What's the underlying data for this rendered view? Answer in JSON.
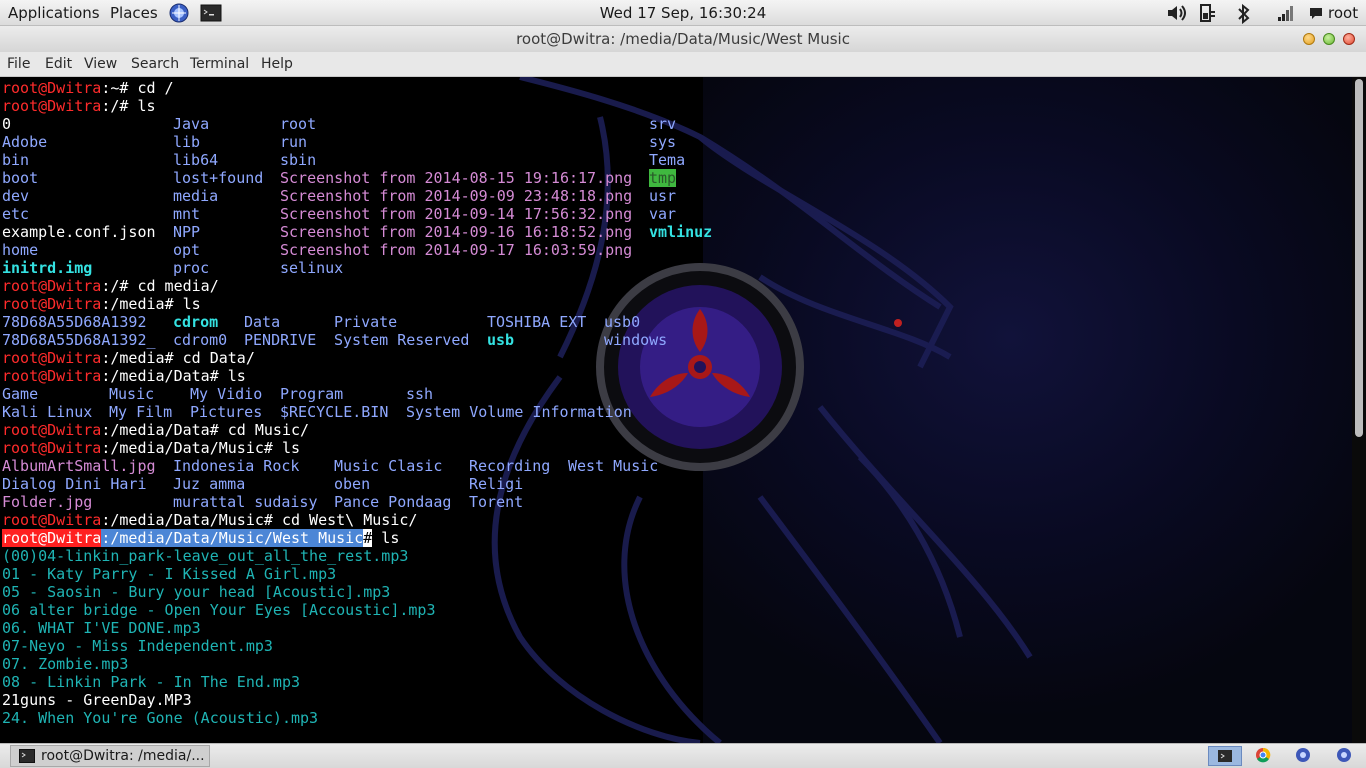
{
  "top_panel": {
    "applications_label": "Applications",
    "places_label": "Places",
    "clock": "Wed 17 Sep, 16:30:24",
    "user": "root",
    "icons": [
      "web-browser-icon",
      "terminal-launcher-icon",
      "volume-icon",
      "battery-icon",
      "bluetooth-icon",
      "network-icon",
      "chat-icon"
    ]
  },
  "window": {
    "title": "root@Dwitra: /media/Data/Music/West Music",
    "menu": {
      "file": "File",
      "edit": "Edit",
      "view": "View",
      "search": "Search",
      "terminal": "Terminal",
      "help": "Help"
    }
  },
  "terminal": {
    "prompt_user": "root@Dwitra",
    "lines": {
      "l1_path": ":~",
      "l1_cmd": "# cd /",
      "l2_path": ":/",
      "l2_cmd": "# ls",
      "root_ls": {
        "col1": [
          "0",
          "Adobe",
          "bin",
          "boot",
          "dev",
          "etc",
          "example.conf.json",
          "home",
          "initrd.img"
        ],
        "col2": [
          "Java",
          "lib",
          "lib64",
          "lost+found",
          "media",
          "mnt",
          "NPP",
          "opt",
          "proc"
        ],
        "col3": [
          "root",
          "run",
          "sbin",
          "Screenshot from 2014-08-15 19:16:17.png",
          "Screenshot from 2014-09-09 23:48:18.png",
          "Screenshot from 2014-09-14 17:56:32.png",
          "Screenshot from 2014-09-16 16:18:52.png",
          "Screenshot from 2014-09-17 16:03:59.png",
          "selinux"
        ],
        "col4": [
          "srv",
          "sys",
          "Tema",
          "tmp",
          "usr",
          "var",
          "vmlinuz"
        ]
      },
      "l3_path": ":/",
      "l3_cmd": "# cd media/",
      "l4_path": ":/media",
      "l4_cmd": "# ls",
      "media_ls": {
        "r1": [
          "78D68A55D68A1392",
          "cdrom",
          "Data",
          "Private",
          "TOSHIBA EXT",
          "usb0"
        ],
        "r2": [
          "78D68A55D68A1392_",
          "cdrom0",
          "PENDRIVE",
          "System Reserved",
          "usb",
          "windows"
        ]
      },
      "l5_path": ":/media",
      "l5_cmd": "# cd Data/",
      "l6_path": ":/media/Data",
      "l6_cmd": "# ls",
      "data_ls": {
        "r1": [
          "Game",
          "Music",
          "My Vidio",
          "Program",
          "ssh"
        ],
        "r2": [
          "Kali Linux",
          "My Film",
          "Pictures",
          "$RECYCLE.BIN",
          "System Volume Information"
        ]
      },
      "l7_path": ":/media/Data",
      "l7_cmd": "# cd Music/",
      "l8_path": ":/media/Data/Music",
      "l8_cmd": "# ls",
      "music_ls": {
        "r1": [
          "AlbumArtSmall.jpg",
          "Indonesia Rock",
          "Music Clasic",
          "Recording",
          "West Music"
        ],
        "r2": [
          "Dialog Dini Hari",
          "Juz amma",
          "oben",
          "Religi"
        ],
        "r3": [
          "Folder.jpg",
          "murattal sudaisy",
          "Pance Pondaag",
          "Torent"
        ]
      },
      "l9_path": ":/media/Data/Music",
      "l9_cmd": "# cd West\\ Music/",
      "l10_path": ":/media/Data/Music/West Music",
      "l10_hash": "#",
      "l10_cmd": " ls",
      "west_ls": [
        "(00)04-linkin_park-leave_out_all_the_rest.mp3",
        "01 - Katy Parry - I Kissed A Girl.mp3",
        "05 - Saosin - Bury your head [Acoustic].mp3",
        "06 alter bridge - Open Your Eyes [Accoustic].mp3",
        "06. WHAT I'VE DONE.mp3",
        "07-Neyo - Miss Independent.mp3",
        "07. Zombie.mp3",
        "08 - Linkin Park - In The End.mp3",
        "21guns - GreenDay.MP3",
        "24. When You're Gone (Acoustic).mp3"
      ]
    }
  },
  "taskbar": {
    "task_label": "root@Dwitra: /media/..."
  },
  "colors": {
    "prompt": "#ff2b2b",
    "path": "#8fa8ff",
    "png": "#d58bd5",
    "exec": "#34e2e2",
    "mp3": "#1fb4b4"
  }
}
